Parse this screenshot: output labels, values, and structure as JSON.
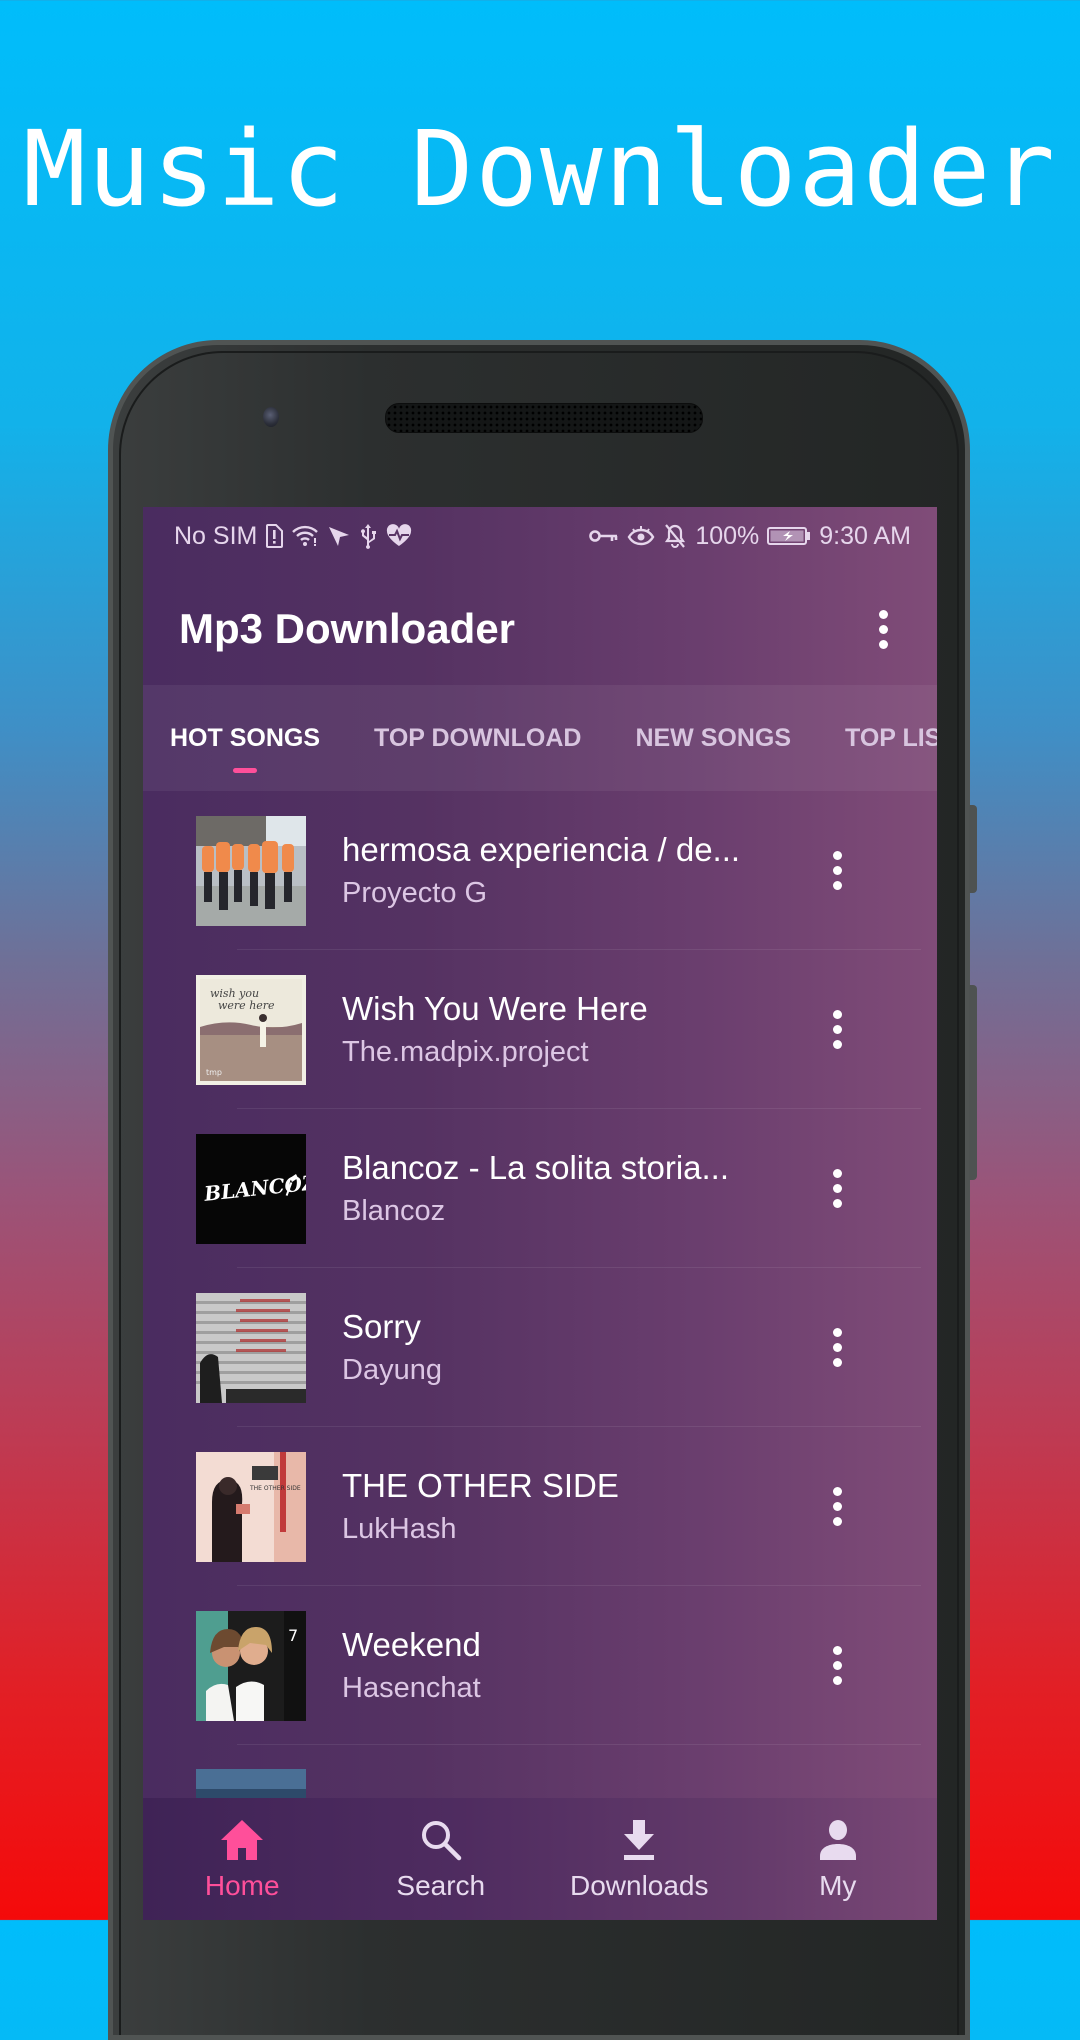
{
  "promo": {
    "title": "Music Downloader"
  },
  "status_bar": {
    "carrier": "No SIM",
    "left_icons": [
      "sim-alert-icon",
      "wifi-icon",
      "send-icon",
      "usb-icon",
      "heart-pulse-icon"
    ],
    "right_icons": [
      "vpn-key-icon",
      "eye-icon",
      "bell-off-icon"
    ],
    "battery_percent": "100%",
    "battery_icon": "battery-charging-icon",
    "time": "9:30 AM"
  },
  "app_bar": {
    "title": "Mp3 Downloader",
    "menu_icon": "more-vert-icon"
  },
  "tabs": [
    {
      "label": "HOT SONGS",
      "active": true
    },
    {
      "label": "TOP DOWNLOAD",
      "active": false
    },
    {
      "label": "NEW SONGS",
      "active": false
    },
    {
      "label": "TOP LIST",
      "active": false
    }
  ],
  "songs": [
    {
      "title": "hermosa experiencia / de...",
      "artist": "Proyecto G",
      "art": "band-photo-orange"
    },
    {
      "title": "Wish You Were Here",
      "artist": "The.madpix.project",
      "art": "wish-you-were-here-cover"
    },
    {
      "title": "Blancoz - La solita storia...",
      "artist": "Blancoz",
      "art": "blancoz-logo-black"
    },
    {
      "title": "Sorry",
      "artist": "Dayung",
      "art": "sorry-cover-bw"
    },
    {
      "title": "THE OTHER SIDE",
      "artist": "LukHash",
      "art": "the-other-side-cover"
    },
    {
      "title": "Weekend",
      "artist": "Hasenchat",
      "art": "weekend-cover"
    }
  ],
  "bottom_nav": [
    {
      "label": "Home",
      "icon": "home-icon",
      "active": true
    },
    {
      "label": "Search",
      "icon": "search-icon",
      "active": false
    },
    {
      "label": "Downloads",
      "icon": "download-icon",
      "active": false
    },
    {
      "label": "My",
      "icon": "person-icon",
      "active": false
    }
  ],
  "colors": {
    "accent": "#ff4f9a",
    "promo_bg_top": "#00bdfb",
    "promo_bg_bottom": "#f50a0a",
    "screen_bg": "#5a3466"
  }
}
